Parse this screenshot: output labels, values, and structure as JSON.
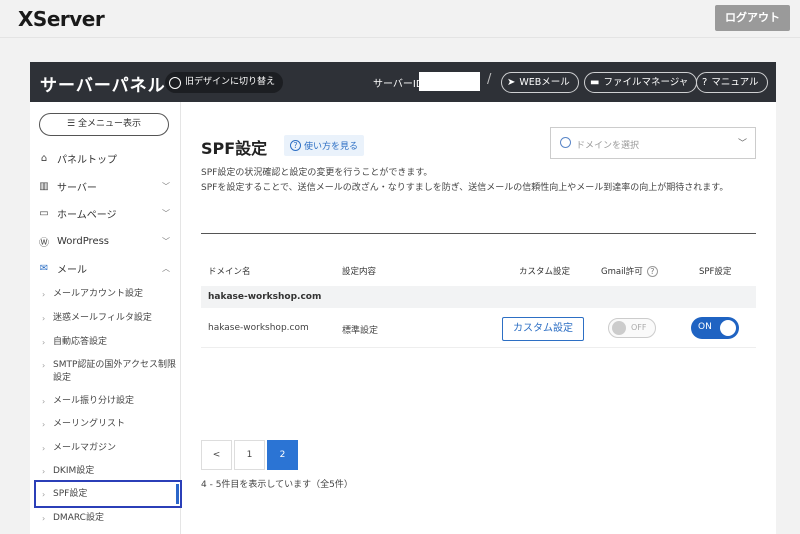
{
  "topbar": {
    "logo": "XServer",
    "logout_label": "ログアウト"
  },
  "header": {
    "title": "サーバーパネル",
    "old_design_label": "旧デザインに切り替え",
    "server_id_label": "サーバーID",
    "separator": "/",
    "webmail_label": "WEBメール",
    "file_manager_label": "ファイルマネージャ",
    "manual_label": "マニュアル"
  },
  "sidebar": {
    "menu_all_label": "全メニュー表示",
    "items": [
      {
        "label": "パネルトップ",
        "icon": "home-icon"
      },
      {
        "label": "サーバー",
        "icon": "server-icon",
        "chevron": "﹀"
      },
      {
        "label": "ホームページ",
        "icon": "window-icon",
        "chevron": "﹀"
      },
      {
        "label": "WordPress",
        "icon": "wordpress-icon",
        "chevron": "﹀"
      },
      {
        "label": "メール",
        "icon": "mail-icon",
        "chevron": "︿"
      }
    ],
    "sub_items": [
      "メールアカウント設定",
      "迷惑メールフィルタ設定",
      "自動応答設定",
      "SMTP認証の国外アクセス制限設定",
      "メール振り分け設定",
      "メーリングリスト",
      "メールマガジン",
      "DKIM設定",
      "SPF設定",
      "DMARC設定"
    ],
    "active_sub": "SPF設定"
  },
  "main": {
    "title": "SPF設定",
    "howto_label": "使い方を見る",
    "domain_select_placeholder": "ドメインを選択",
    "description": "SPF設定の状況確認と設定の変更を行うことができます。\nSPFを設定することで、送信メールの改ざん・なりすましを防ぎ、送信メールの信頼性向上やメール到達率の向上が期待されます。",
    "table": {
      "headers": [
        "ドメイン名",
        "設定内容",
        "カスタム設定",
        "Gmail許可",
        "SPF設定"
      ],
      "group_label": "hakase-workshop.com",
      "rows": [
        {
          "domain": "hakase-workshop.com",
          "setting": "標準設定",
          "custom_button": "カスタム設定",
          "gmail": "OFF",
          "spf": "ON"
        }
      ]
    },
    "pagination": {
      "prev": "<",
      "pages": [
        "1",
        "2"
      ],
      "current": "2"
    },
    "count_text": "4 - 5件目を表示しています（全5件）"
  },
  "colors": {
    "accent": "#2b74d4",
    "header_bg": "#2e3137",
    "active_border": "#2b3fb8"
  }
}
